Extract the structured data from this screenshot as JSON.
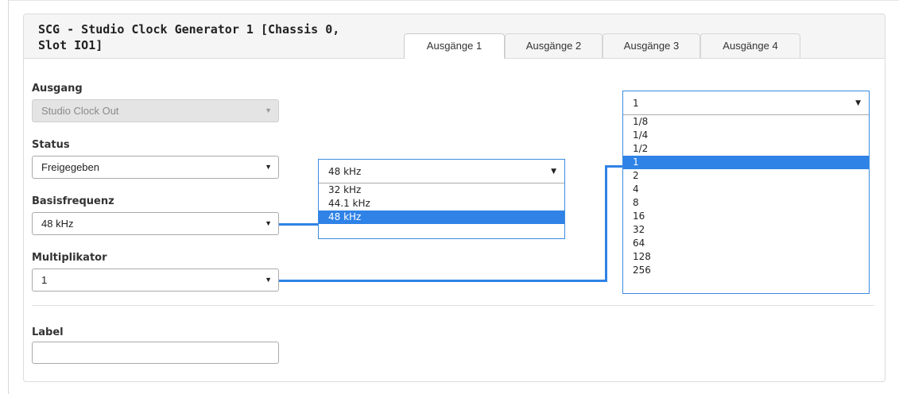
{
  "panel": {
    "title": "SCG - Studio Clock Generator 1 [Chassis 0,\nSlot IO1]",
    "tabs": [
      "Ausgänge 1",
      "Ausgänge 2",
      "Ausgänge 3",
      "Ausgänge 4"
    ],
    "active_tab": "Ausgänge 1"
  },
  "form": {
    "ausgang": {
      "label": "Ausgang",
      "value": "Studio Clock Out",
      "disabled": true
    },
    "status": {
      "label": "Status",
      "value": "Freigegeben"
    },
    "basisfrequenz": {
      "label": "Basisfrequenz",
      "value": "48 kHz"
    },
    "multiplikator": {
      "label": "Multiplikator",
      "value": "1"
    },
    "label": {
      "label": "Label",
      "value": ""
    }
  },
  "dropdowns": {
    "basisfrequenz": {
      "selected": "48 kHz",
      "options": [
        "32 kHz",
        "44.1 kHz",
        "48 kHz"
      ]
    },
    "multiplikator": {
      "selected": "1",
      "options": [
        "1/8",
        "1/4",
        "1/2",
        "1",
        "2",
        "4",
        "8",
        "16",
        "32",
        "64",
        "128",
        "256"
      ]
    }
  },
  "colors": {
    "accent": "#2f82e6",
    "header_bg": "#f5f5f5",
    "disabled_bg": "#e4e4e4"
  },
  "icons": {
    "select_arrow": "caret-down-icon"
  }
}
